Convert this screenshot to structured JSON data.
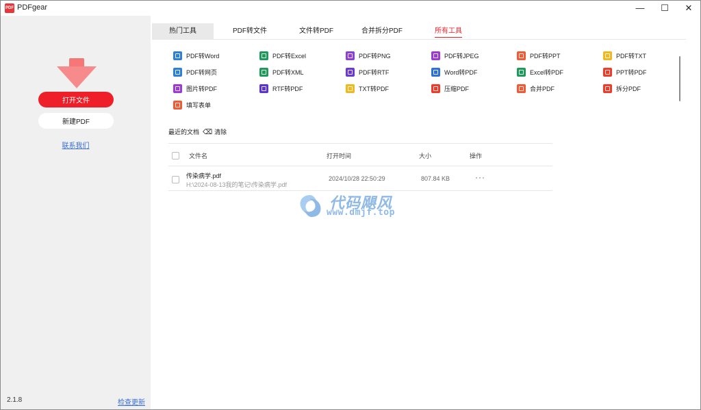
{
  "window": {
    "title": "PDFgear",
    "logo_text": "PDF",
    "controls": {
      "minimize": "—",
      "maximize": "☐",
      "close": "✕"
    }
  },
  "sidebar": {
    "open_file": "打开文件",
    "new_pdf": "新建PDF",
    "contact": "联系我们",
    "version": "2.1.8",
    "check_update": "检查更新",
    "drop_icon": "download-arrow-icon"
  },
  "tabs": [
    {
      "label": "热门工具",
      "state": "hover"
    },
    {
      "label": "PDF转文件",
      "state": "normal"
    },
    {
      "label": "文件转PDF",
      "state": "normal"
    },
    {
      "label": "合并拆分PDF",
      "state": "normal"
    },
    {
      "label": "所有工具",
      "state": "selected"
    }
  ],
  "tools": [
    {
      "label": "PDF转Word",
      "color": "#2f7fd9",
      "icon": "pdf-to-word-icon"
    },
    {
      "label": "PDF转Excel",
      "color": "#1f9a5b",
      "icon": "pdf-to-excel-icon"
    },
    {
      "label": "PDF转PNG",
      "color": "#8e3fd8",
      "icon": "pdf-to-png-icon"
    },
    {
      "label": "PDF转JPEG",
      "color": "#9b3ad6",
      "icon": "pdf-to-jpeg-icon"
    },
    {
      "label": "PDF转PPT",
      "color": "#f05b35",
      "icon": "pdf-to-ppt-icon"
    },
    {
      "label": "PDF转TXT",
      "color": "#f2b81f",
      "icon": "pdf-to-txt-icon"
    },
    {
      "label": "PDF转网页",
      "color": "#2f7fd9",
      "icon": "pdf-to-html-icon"
    },
    {
      "label": "PDF转XML",
      "color": "#1f9a5b",
      "icon": "pdf-to-xml-icon"
    },
    {
      "label": "PDF转RTF",
      "color": "#6a3ad6",
      "icon": "pdf-to-rtf-icon"
    },
    {
      "label": "Word转PDF",
      "color": "#2f6fd9",
      "icon": "word-to-pdf-icon"
    },
    {
      "label": "Excel转PDF",
      "color": "#1f9a5b",
      "icon": "excel-to-pdf-icon"
    },
    {
      "label": "PPT转PDF",
      "color": "#ef3b2a",
      "icon": "ppt-to-pdf-icon"
    },
    {
      "label": "图片转PDF",
      "color": "#9b3ad6",
      "icon": "image-to-pdf-icon"
    },
    {
      "label": "RTF转PDF",
      "color": "#5a34d6",
      "icon": "rtf-to-pdf-icon"
    },
    {
      "label": "TXT转PDF",
      "color": "#f2b81f",
      "icon": "txt-to-pdf-icon"
    },
    {
      "label": "压缩PDF",
      "color": "#ef3b2a",
      "icon": "compress-pdf-icon"
    },
    {
      "label": "合并PDF",
      "color": "#f05b35",
      "icon": "merge-pdf-icon"
    },
    {
      "label": "拆分PDF",
      "color": "#ef3b2a",
      "icon": "split-pdf-icon"
    },
    {
      "label": "填写表单",
      "color": "#f05b35",
      "icon": "fill-form-icon"
    }
  ],
  "recent": {
    "title": "最近的文档",
    "clear": "清除",
    "columns": {
      "name": "文件名",
      "time": "打开时间",
      "size": "大小",
      "action": "操作"
    },
    "rows": [
      {
        "name": "传染病学.pdf",
        "path": "H:\\2024-08-13我的笔记\\传染病学.pdf",
        "time": "2024/10/28 22:50:29",
        "size": "807.84 KB",
        "more": "···"
      }
    ]
  },
  "watermark": {
    "title": "代码飓风",
    "url": "www.dmjf.top"
  },
  "colors": {
    "accent": "#ef1f2a",
    "link": "#3a6fd8",
    "sidebar": "#f0f0f0"
  }
}
